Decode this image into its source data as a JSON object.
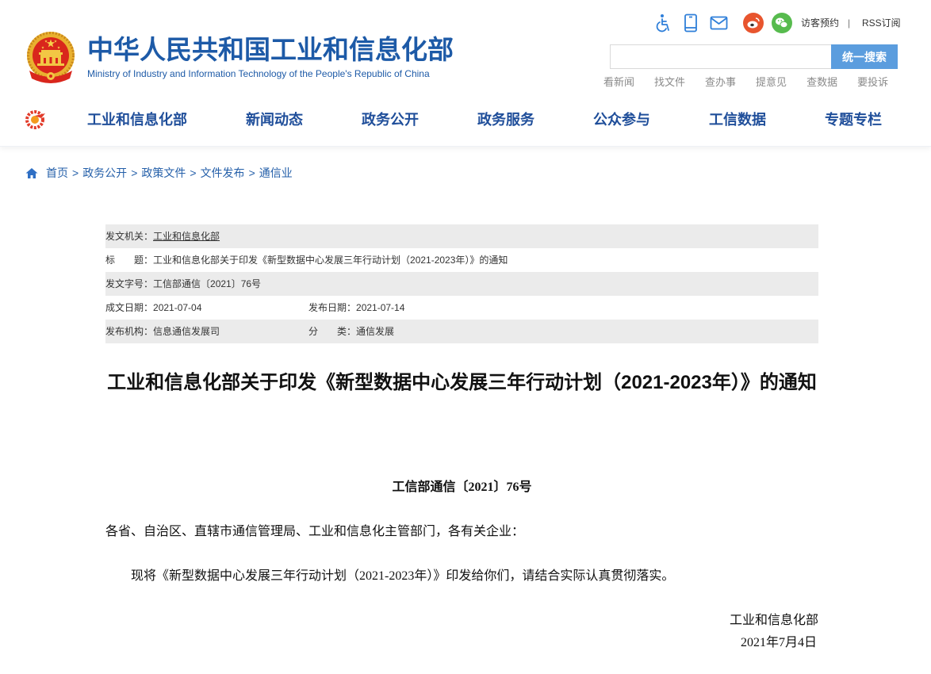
{
  "header": {
    "title": "中华人民共和国工业和信息化部",
    "subtitle": "Ministry of Industry and Information Technology of the People's Republic of China",
    "emblem_icon": "national-emblem-icon",
    "tool_icons": [
      "accessibility-icon",
      "mobile-icon",
      "mail-icon",
      "weibo-icon",
      "wechat-icon"
    ],
    "top_links": {
      "visitor": "访客预约",
      "separator": "|",
      "rss": "RSS订阅"
    },
    "search": {
      "placeholder": "",
      "value": "",
      "button": "统一搜索"
    },
    "quick_links": [
      "看新闻",
      "找文件",
      "查办事",
      "提意见",
      "查数据",
      "要投诉"
    ]
  },
  "nav": {
    "logo_icon": "ministry-logo-icon",
    "items": [
      "工业和信息化部",
      "新闻动态",
      "政务公开",
      "政务服务",
      "公众参与",
      "工信数据",
      "专题专栏"
    ]
  },
  "breadcrumb": {
    "icon": "home-icon",
    "separator": ">",
    "items": [
      "首页",
      "政务公开",
      "政策文件",
      "文件发布",
      "通信业"
    ]
  },
  "meta": {
    "issuer": {
      "label": "发文机关：",
      "value": "工业和信息化部"
    },
    "title": {
      "label": "标　　题：",
      "value": "工业和信息化部关于印发《新型数据中心发展三年行动计划（2021-2023年）》的通知"
    },
    "doc_no": {
      "label": "发文字号：",
      "value": "工信部通信〔2021〕76号"
    },
    "written_date": {
      "label": "成文日期：",
      "value": "2021-07-04"
    },
    "publish_date": {
      "label": "发布日期：",
      "value": "2021-07-14"
    },
    "publisher": {
      "label": "发布机构：",
      "value": "信息通信发展司"
    },
    "category": {
      "label": "分　　类：",
      "value": "通信发展"
    }
  },
  "article": {
    "title": "工业和信息化部关于印发《新型数据中心发展三年行动计划（2021-2023年）》的通知",
    "doc_number": "工信部通信〔2021〕76号",
    "salutation": "各省、自治区、直辖市通信管理局、工业和信息化主管部门，各有关企业：",
    "body": "现将《新型数据中心发展三年行动计划（2021-2023年）》印发给你们，请结合实际认真贯彻落实。",
    "signature": "工业和信息化部",
    "date": "2021年7月4日"
  },
  "colors": {
    "brand_blue": "#1d5aa7",
    "nav_text": "#1f4e9a",
    "search_button": "#5b9dde",
    "quick_link": "#8a8a8a",
    "meta_row_bg": "#ebebeb",
    "weibo": "#e8552e",
    "wechat": "#57bb4e",
    "emblem_red": "#d9261c",
    "emblem_gold": "#e9b130"
  }
}
